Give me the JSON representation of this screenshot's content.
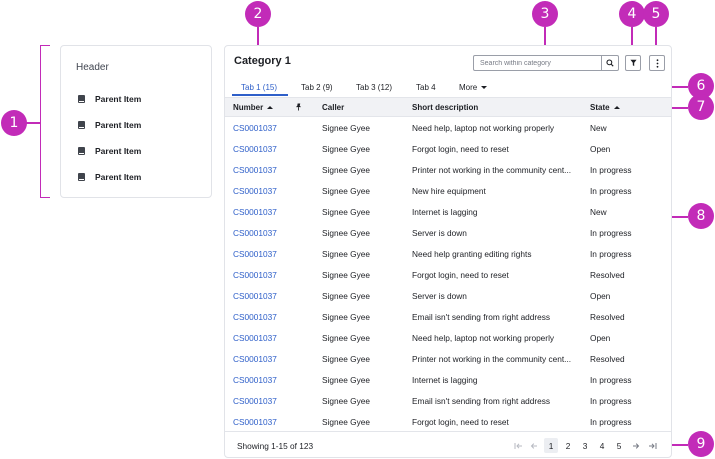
{
  "colors": {
    "accent": "#2e5fc9",
    "callout": "#c22bb8",
    "header_bg": "#f1f2f5"
  },
  "callouts": [
    "1",
    "2",
    "3",
    "4",
    "5",
    "6",
    "7",
    "8",
    "9"
  ],
  "sidebar": {
    "header": "Header",
    "items": [
      {
        "label": "Parent Item",
        "icon": "book-icon"
      },
      {
        "label": "Parent Item",
        "icon": "book-icon"
      },
      {
        "label": "Parent Item",
        "icon": "book-icon"
      },
      {
        "label": "Parent Item",
        "icon": "book-icon"
      }
    ]
  },
  "main": {
    "title": "Category 1",
    "search": {
      "placeholder": "Search within category",
      "value": "",
      "icon": "search-icon"
    },
    "filter_icon": "filter-icon",
    "more_icon": "kebab-menu-icon",
    "tabs": [
      {
        "label": "Tab 1 (15)",
        "active": true
      },
      {
        "label": "Tab 2 (9)",
        "active": false
      },
      {
        "label": "Tab 3 (12)",
        "active": false
      },
      {
        "label": "Tab 4",
        "active": false
      },
      {
        "label": "More",
        "active": false,
        "icon": "caret-down-icon"
      }
    ],
    "columns": {
      "number": "Number",
      "pin_icon": "pin-icon",
      "caller": "Caller",
      "short_description": "Short description",
      "state": "State"
    },
    "rows": [
      {
        "number": "CS0001037",
        "caller": "Signee Gyee",
        "description": "Need help, laptop not working properly",
        "state": "New"
      },
      {
        "number": "CS0001037",
        "caller": "Signee Gyee",
        "description": "Forgot login, need to reset",
        "state": "Open"
      },
      {
        "number": "CS0001037",
        "caller": "Signee Gyee",
        "description": "Printer not working in the community cent...",
        "state": "In progress"
      },
      {
        "number": "CS0001037",
        "caller": "Signee Gyee",
        "description": "New hire equipment",
        "state": "In progress"
      },
      {
        "number": "CS0001037",
        "caller": "Signee Gyee",
        "description": "Internet is lagging",
        "state": "New"
      },
      {
        "number": "CS0001037",
        "caller": "Signee Gyee",
        "description": "Server is down",
        "state": "In progress"
      },
      {
        "number": "CS0001037",
        "caller": "Signee Gyee",
        "description": "Need help granting editing rights",
        "state": "In progress"
      },
      {
        "number": "CS0001037",
        "caller": "Signee Gyee",
        "description": "Forgot login, need to reset",
        "state": "Resolved"
      },
      {
        "number": "CS0001037",
        "caller": "Signee Gyee",
        "description": "Server is down",
        "state": "Open"
      },
      {
        "number": "CS0001037",
        "caller": "Signee Gyee",
        "description": "Email isn't sending from right address",
        "state": "Resolved"
      },
      {
        "number": "CS0001037",
        "caller": "Signee Gyee",
        "description": "Need help, laptop not working properly",
        "state": "Open"
      },
      {
        "number": "CS0001037",
        "caller": "Signee Gyee",
        "description": "Printer not working in the community cent...",
        "state": "Resolved"
      },
      {
        "number": "CS0001037",
        "caller": "Signee Gyee",
        "description": "Internet is lagging",
        "state": "In progress"
      },
      {
        "number": "CS0001037",
        "caller": "Signee Gyee",
        "description": "Email isn't sending from right address",
        "state": "In progress"
      },
      {
        "number": "CS0001037",
        "caller": "Signee Gyee",
        "description": "Forgot login, need to reset",
        "state": "In progress"
      }
    ],
    "footer": {
      "showing": "Showing 1-15 of 123",
      "pages": [
        "1",
        "2",
        "3",
        "4",
        "5"
      ],
      "current_page": "1",
      "first_icon": "first-page-icon",
      "prev_icon": "prev-page-icon",
      "next_icon": "next-page-icon",
      "last_icon": "last-page-icon"
    }
  }
}
